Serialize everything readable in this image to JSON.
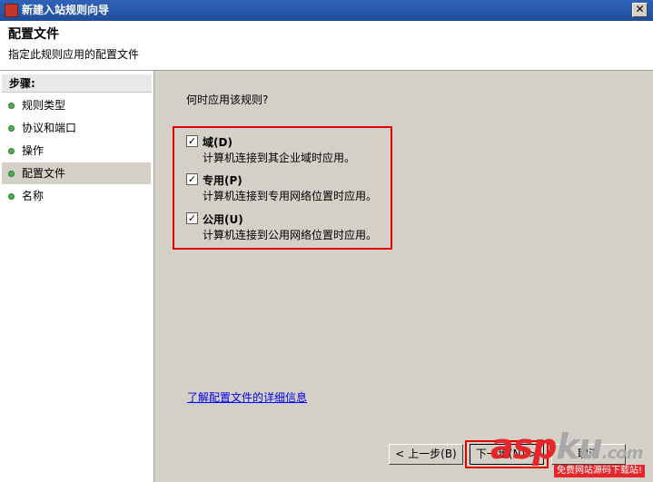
{
  "window": {
    "title": "新建入站规则向导",
    "close_label": "✕"
  },
  "header": {
    "title": "配置文件",
    "subtitle": "指定此规则应用的配置文件"
  },
  "sidebar": {
    "steps_label": "步骤:",
    "items": [
      {
        "label": "规则类型"
      },
      {
        "label": "协议和端口"
      },
      {
        "label": "操作"
      },
      {
        "label": "配置文件"
      },
      {
        "label": "名称"
      }
    ],
    "current_index": 3
  },
  "main": {
    "question": "何时应用该规则?",
    "options": [
      {
        "label": "域(D)",
        "desc": "计算机连接到其企业域时应用。",
        "checked": true
      },
      {
        "label": "专用(P)",
        "desc": "计算机连接到专用网络位置时应用。",
        "checked": true
      },
      {
        "label": "公用(U)",
        "desc": "计算机连接到公用网络位置时应用。",
        "checked": true
      }
    ],
    "learn_more": "了解配置文件的详细信息"
  },
  "buttons": {
    "back": "< 上一步(B)",
    "next": "下一步(N) >",
    "cancel": "取消"
  },
  "watermark": {
    "brand_red": "asp",
    "brand_gray": "ku",
    "brand_tld": ".com",
    "sub": "免费网站源码下载站!"
  },
  "colors": {
    "highlight": "#e00000",
    "accent": "#1f4e9b"
  }
}
